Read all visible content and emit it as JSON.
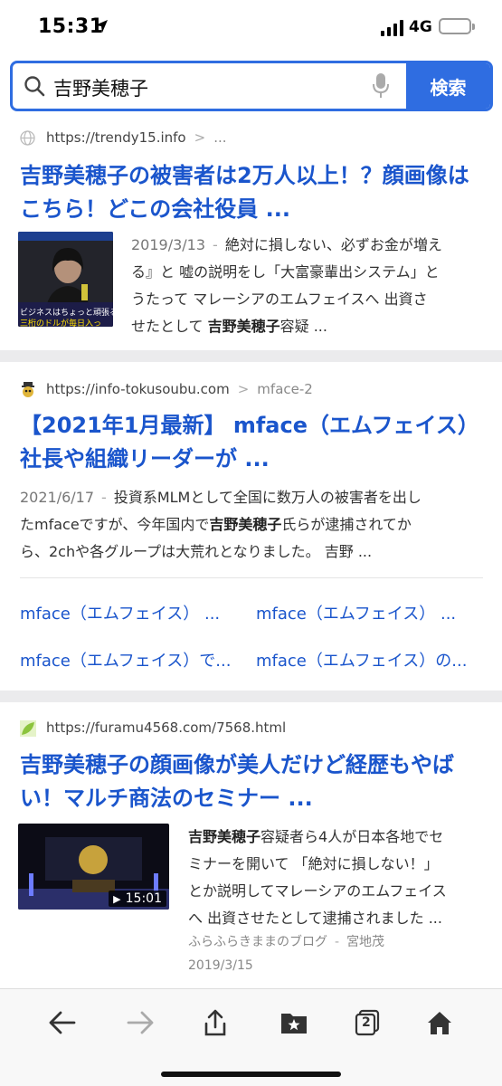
{
  "status_bar": {
    "time": "15:31",
    "network": "4G"
  },
  "search": {
    "query": "吉野美穂子",
    "button_label": "検索"
  },
  "results": [
    {
      "url": "https://trendy15.info",
      "path": "...",
      "title_line1": "吉野美穂子の被害者は2万人以上！？顔画像は",
      "title_line2": "こちら！どこの会社役員 ...",
      "date": "2019/3/13",
      "thumb_text1": "ビジネスはちょっと頑張る",
      "thumb_text2": "三桁のドルが毎日入っ",
      "snippet_l1": "絶対に損しない、必ずお金が増え",
      "snippet_l2": "る』と 嘘の説明をし「大富豪輩出システム」と",
      "snippet_l3": "うたって マレーシアのエムフェイスへ 出資さ",
      "snippet_l4_pre": "せたとして ",
      "snippet_l4_bold": "吉野美穂子",
      "snippet_l4_post": "容疑 ..."
    },
    {
      "url": "https://info-tokusoubu.com",
      "path": "mface-2",
      "title_line1": "【2021年1月最新】 mface（エムフェイス）",
      "title_line2": "社長や組織リーダーが ...",
      "date": "2021/6/17",
      "snippet_l1": "投資系MLMとして全国に数万人の被害者を出し",
      "snippet_l2_pre": "たmfaceですが、今年国内で",
      "snippet_l2_bold": "吉野美穂子",
      "snippet_l2_post": "氏らが逮捕されてか",
      "snippet_l3": "ら、2chや各グループは大荒れとなりました。 吉野 ...",
      "sitelinks": [
        "mface（エムフェイス） ...",
        "mface（エムフェイス） ...",
        "mface（エムフェイス）で...",
        "mface（エムフェイス）の..."
      ]
    },
    {
      "url": "https://furamu4568.com/7568.html",
      "title_line1": "吉野美穂子の顔画像が美人だけど経歴もやば",
      "title_line2": "い！マルチ商法のセミナー ...",
      "video_duration": "15:01",
      "snippet_l1_bold": "吉野美穂子",
      "snippet_l1_post": "容疑者ら4人が日本各地でセ",
      "snippet_l2": "ミナーを開いて 「絶対に損しない！」",
      "snippet_l3": "とか説明してマレーシアのエムフェイス",
      "snippet_l4": "へ 出資させたとして逮捕されました ...",
      "source": "ふらふらきままのブログ",
      "author": "宮地茂",
      "date": "2019/3/15"
    }
  ],
  "toolbar": {
    "tabs_count": "2"
  },
  "colors": {
    "accent": "#2f6de1",
    "link": "#1a55cc"
  }
}
